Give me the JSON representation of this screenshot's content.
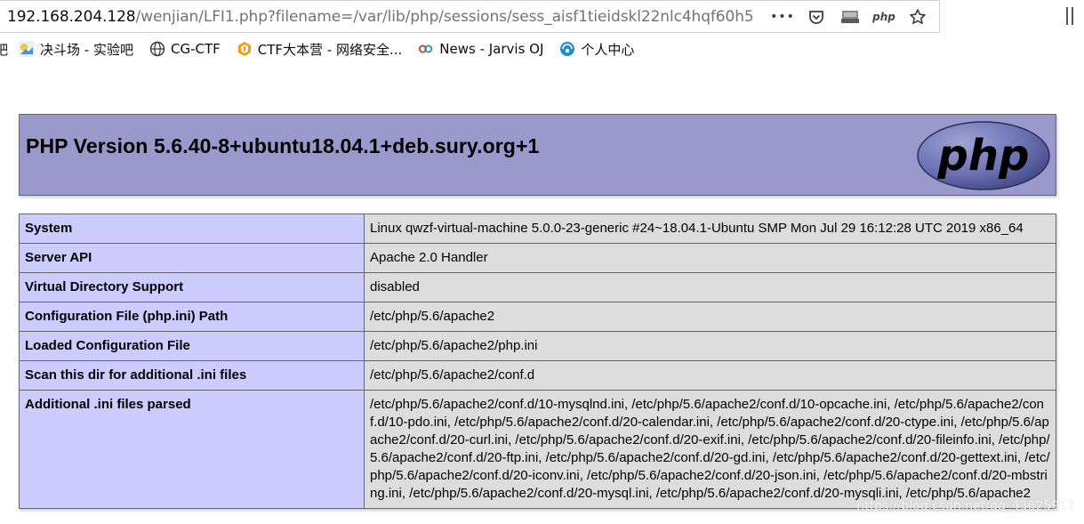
{
  "browser": {
    "url_host": "192.168.204.128",
    "url_path": "/wenjian/LFI1.php?filename=/var/lib/php/sessions/sess_aisf1tieidskl22nlc4hqf60h5",
    "more_icon_label": "•••",
    "reader_ext_label": "php",
    "icons": [
      "more-actions-icon",
      "pocket-icon",
      "screenshot-icon",
      "php-extension-icon",
      "star-icon",
      "library-icon"
    ]
  },
  "bookmarks": [
    {
      "label": "决斗场 - 实验吧",
      "icon": "juedou-icon",
      "color": "#4a90d9"
    },
    {
      "label": "CG-CTF",
      "icon": "globe-icon",
      "color": "#333333"
    },
    {
      "label": "CTF大本营 - 网络安全...",
      "icon": "ctf-icon",
      "color": "#f39c12"
    },
    {
      "label": "News - Jarvis OJ",
      "icon": "jarvis-icon",
      "color": "#c0392b"
    },
    {
      "label": "个人中心",
      "icon": "user-center-icon",
      "color": "#1a8fd1"
    }
  ],
  "bookmark_cut": "吧",
  "phpinfo": {
    "title": "PHP Version 5.6.40-8+ubuntu18.04.1+deb.sury.org+1",
    "logo_text": "php",
    "rows": [
      {
        "key": "System",
        "value": "Linux qwzf-virtual-machine 5.0.0-23-generic #24~18.04.1-Ubuntu SMP Mon Jul 29 16:12:28 UTC 2019 x86_64"
      },
      {
        "key": "Server API",
        "value": "Apache 2.0 Handler"
      },
      {
        "key": "Virtual Directory Support",
        "value": "disabled"
      },
      {
        "key": "Configuration File (php.ini) Path",
        "value": "/etc/php/5.6/apache2"
      },
      {
        "key": "Loaded Configuration File",
        "value": "/etc/php/5.6/apache2/php.ini"
      },
      {
        "key": "Scan this dir for additional .ini files",
        "value": "/etc/php/5.6/apache2/conf.d"
      },
      {
        "key": "Additional .ini files parsed",
        "value": "/etc/php/5.6/apache2/conf.d/10-mysqlnd.ini, /etc/php/5.6/apache2/conf.d/10-opcache.ini, /etc/php/5.6/apache2/conf.d/10-pdo.ini, /etc/php/5.6/apache2/conf.d/20-calendar.ini, /etc/php/5.6/apache2/conf.d/20-ctype.ini, /etc/php/5.6/apache2/conf.d/20-curl.ini, /etc/php/5.6/apache2/conf.d/20-exif.ini, /etc/php/5.6/apache2/conf.d/20-fileinfo.ini, /etc/php/5.6/apache2/conf.d/20-ftp.ini, /etc/php/5.6/apache2/conf.d/20-gd.ini, /etc/php/5.6/apache2/conf.d/20-gettext.ini, /etc/php/5.6/apache2/conf.d/20-iconv.ini, /etc/php/5.6/apache2/conf.d/20-json.ini, /etc/php/5.6/apache2/conf.d/20-mbstring.ini, /etc/php/5.6/apache2/conf.d/20-mysql.ini, /etc/php/5.6/apache2/conf.d/20-mysqli.ini, /etc/php/5.6/apache2"
      }
    ]
  },
  "watermark": "https://blog.csdn.net/qq_43625917",
  "colors": {
    "header_bg": "#9999cc",
    "key_bg": "#ccccff",
    "value_bg": "#dddddd",
    "border": "#666666"
  }
}
